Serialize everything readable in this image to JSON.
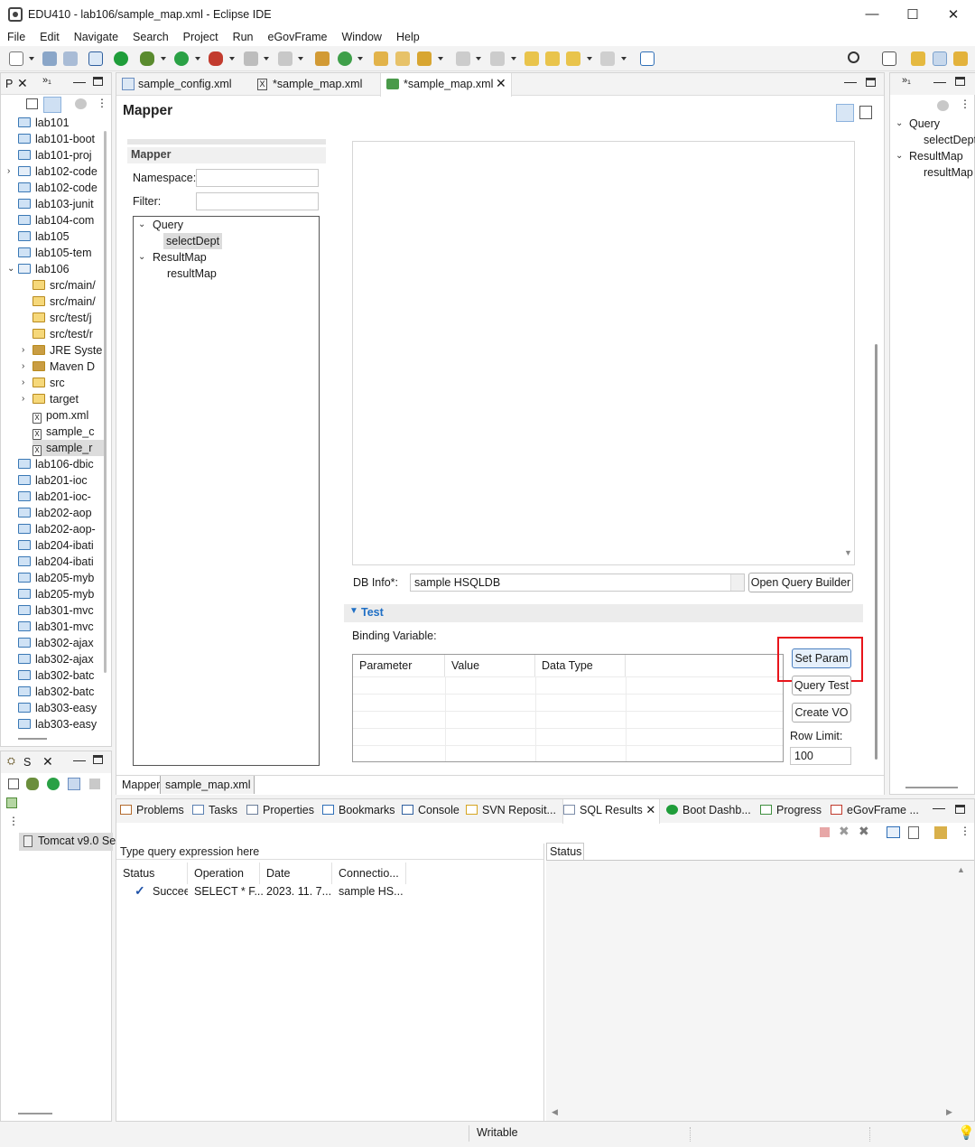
{
  "window": {
    "title": "EDU410 - lab106/sample_map.xml - Eclipse IDE",
    "minimize": "—",
    "maximize": "☐",
    "close": "✕"
  },
  "menu": [
    "File",
    "Edit",
    "Navigate",
    "Search",
    "Project",
    "Run",
    "eGovFrame",
    "Window",
    "Help"
  ],
  "explorer": {
    "tab_label": "P",
    "items": [
      {
        "label": "lab101"
      },
      {
        "label": "lab101-boot"
      },
      {
        "label": "lab101-proj"
      },
      {
        "label": "lab102-code"
      },
      {
        "label": "lab102-code"
      },
      {
        "label": "lab103-junit"
      },
      {
        "label": "lab104-com"
      },
      {
        "label": "lab105"
      },
      {
        "label": "lab105-tem"
      },
      {
        "label": "lab106"
      },
      {
        "label": "src/main/"
      },
      {
        "label": "src/main/"
      },
      {
        "label": "src/test/j"
      },
      {
        "label": "src/test/r"
      },
      {
        "label": "JRE Syste"
      },
      {
        "label": "Maven D"
      },
      {
        "label": "src"
      },
      {
        "label": "target"
      },
      {
        "label": "pom.xml"
      },
      {
        "label": "sample_c"
      },
      {
        "label": "sample_r"
      },
      {
        "label": "lab106-dbic"
      },
      {
        "label": "lab201-ioc"
      },
      {
        "label": "lab201-ioc-"
      },
      {
        "label": "lab202-aop"
      },
      {
        "label": "lab202-aop-"
      },
      {
        "label": "lab204-ibati"
      },
      {
        "label": "lab204-ibati"
      },
      {
        "label": "lab205-myb"
      },
      {
        "label": "lab205-myb"
      },
      {
        "label": "lab301-mvc"
      },
      {
        "label": "lab301-mvc"
      },
      {
        "label": "lab302-ajax"
      },
      {
        "label": "lab302-ajax"
      },
      {
        "label": "lab302-batc"
      },
      {
        "label": "lab302-batc"
      },
      {
        "label": "lab303-easy"
      },
      {
        "label": "lab303-easy"
      }
    ]
  },
  "servers": {
    "tab_label": "S",
    "server": "Tomcat v9.0 Se"
  },
  "editor_tabs": [
    {
      "label": "sample_config.xml"
    },
    {
      "label": "*sample_map.xml"
    },
    {
      "label": "*sample_map.xml"
    }
  ],
  "editor": {
    "title": "Mapper",
    "section_title": "Mapper",
    "namespace_label": "Namespace:",
    "namespace_value": "",
    "filter_label": "Filter:",
    "filter_value": "",
    "tree": {
      "query": "Query",
      "query_child": "selectDept",
      "resultmap": "ResultMap",
      "resultmap_child": "resultMap"
    },
    "db_info_label": "DB Info*:",
    "db_info_value": "sample HSQLDB",
    "open_query_builder": "Open Query Builder",
    "test_section": "Test",
    "binding_variable_label": "Binding Variable:",
    "columns": [
      "Parameter",
      "Value",
      "Data Type"
    ],
    "set_param": "Set Param",
    "query_test": "Query Test",
    "create_vo": "Create VO",
    "row_limit_label": "Row Limit:",
    "row_limit_value": "100",
    "bottom_tabs": [
      "Mapper",
      "sample_map.xml"
    ]
  },
  "outline": {
    "query": "Query",
    "query_child": "selectDept",
    "resultmap": "ResultMap",
    "resultmap_child": "resultMap"
  },
  "bottom_tabs": [
    "Problems",
    "Tasks",
    "Properties",
    "Bookmarks",
    "Console",
    "SVN Reposit...",
    "SQL Results",
    "Boot Dashb...",
    "Progress",
    "eGovFrame ..."
  ],
  "sql_results": {
    "filter_placeholder": "Type query expression here",
    "columns": [
      "Status",
      "Operation",
      "Date",
      "Connectio..."
    ],
    "row": {
      "status": "Succeed",
      "operation": "SELECT * F...",
      "date": "2023. 11. 7...",
      "connection": "sample HS..."
    },
    "status_tab": "Status"
  },
  "statusbar": {
    "mode": "Writable"
  },
  "colors": {
    "highlight_box": "#e8141b",
    "accent": "#1f6fc5"
  }
}
